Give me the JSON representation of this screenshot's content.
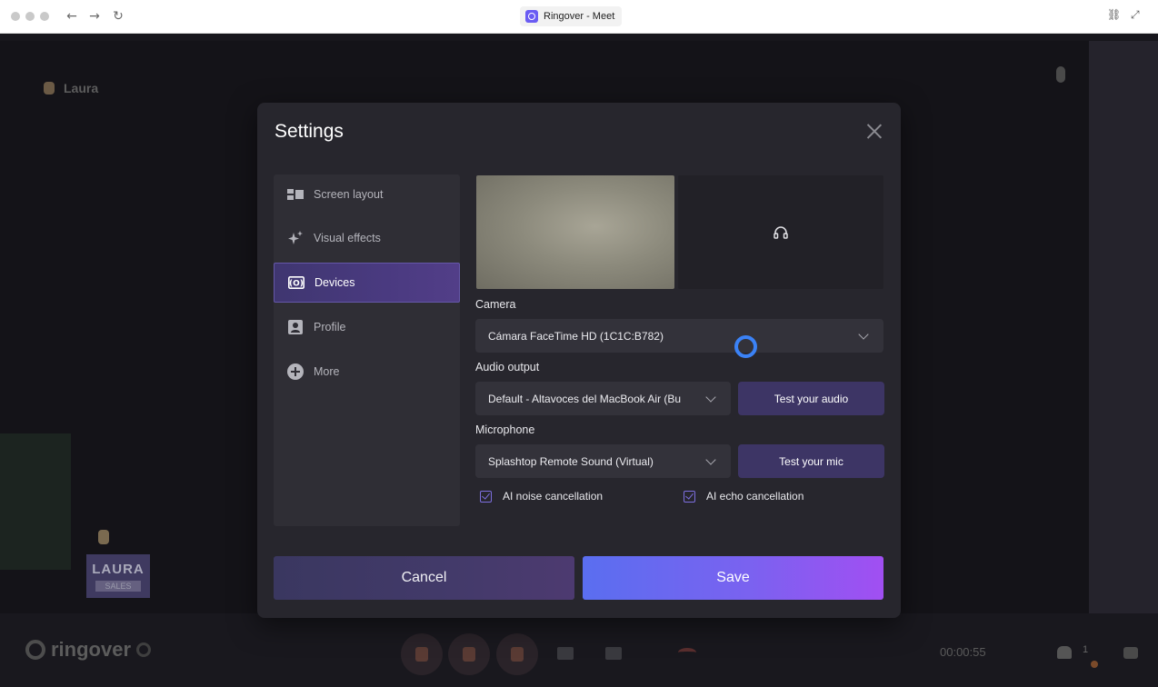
{
  "browser": {
    "tab_title": "Ringover - Meet"
  },
  "meeting": {
    "participant_name": "Laura",
    "card_name": "LAURA",
    "card_role": "SALES",
    "logo_text": "ringover",
    "timer": "00:00:55",
    "participant_count": "1"
  },
  "settings": {
    "title": "Settings",
    "nav": [
      {
        "label": "Screen layout",
        "icon": "screen-layout-icon"
      },
      {
        "label": "Visual effects",
        "icon": "sparkles-icon"
      },
      {
        "label": "Devices",
        "icon": "devices-icon",
        "active": true
      },
      {
        "label": "Profile",
        "icon": "profile-icon"
      },
      {
        "label": "More",
        "icon": "plus-circle-icon"
      }
    ],
    "camera_label": "Camera",
    "camera_value": "Cámara FaceTime HD (1C1C:B782)",
    "audio_output_label": "Audio output",
    "audio_output_value": "Default - Altavoces del MacBook Air (Bu",
    "test_audio_label": "Test your audio",
    "microphone_label": "Microphone",
    "microphone_value": "Splashtop Remote Sound (Virtual)",
    "test_mic_label": "Test your mic",
    "noise_cancel_label": "AI noise cancellation",
    "echo_cancel_label": "AI echo cancellation",
    "cancel_label": "Cancel",
    "save_label": "Save"
  },
  "colors": {
    "accent": "#6a5cf3",
    "save_gradient_start": "#5a6ef0",
    "save_gradient_end": "#a14ff2",
    "spinner": "#3b82f6"
  }
}
